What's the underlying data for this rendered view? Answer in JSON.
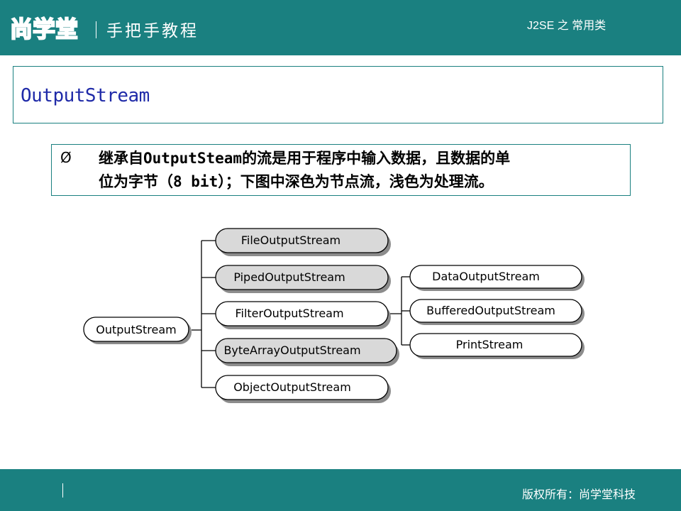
{
  "header": {
    "logo_text": "尚学堂",
    "slogan": "手把手教程",
    "course": "J2SE 之 常用类"
  },
  "title": "OutputStream",
  "description": {
    "bullet": "Ø",
    "line1_prefix": "继承自",
    "line1_code": "OutputSteam",
    "line1_suffix": "的流是用于程序中输入数据，且数据的单",
    "line2_prefix": "位为字节（",
    "line2_code": "8 bit",
    "line2_suffix": "）；下图中深色为节点流，浅色为处理流。"
  },
  "diagram": {
    "root": "OutputStream",
    "children": [
      {
        "label": "FileOutputStream",
        "dark": true
      },
      {
        "label": "PipedOutputStream",
        "dark": true
      },
      {
        "label": "FilterOutputStream",
        "dark": false
      },
      {
        "label": "ByteArrayOutputStream",
        "dark": true
      },
      {
        "label": "ObjectOutputStream",
        "dark": false
      }
    ],
    "filter_children": [
      {
        "label": "DataOutputStream",
        "dark": false
      },
      {
        "label": "BufferedOutputStream",
        "dark": false
      },
      {
        "label": "PrintStream",
        "dark": false
      }
    ],
    "colors": {
      "dark_fill": "#d9d9d9",
      "light_fill": "#ffffff",
      "shadow": "#8c8c8c"
    }
  },
  "footer": {
    "copyright": "版权所有：尚学堂科技"
  }
}
